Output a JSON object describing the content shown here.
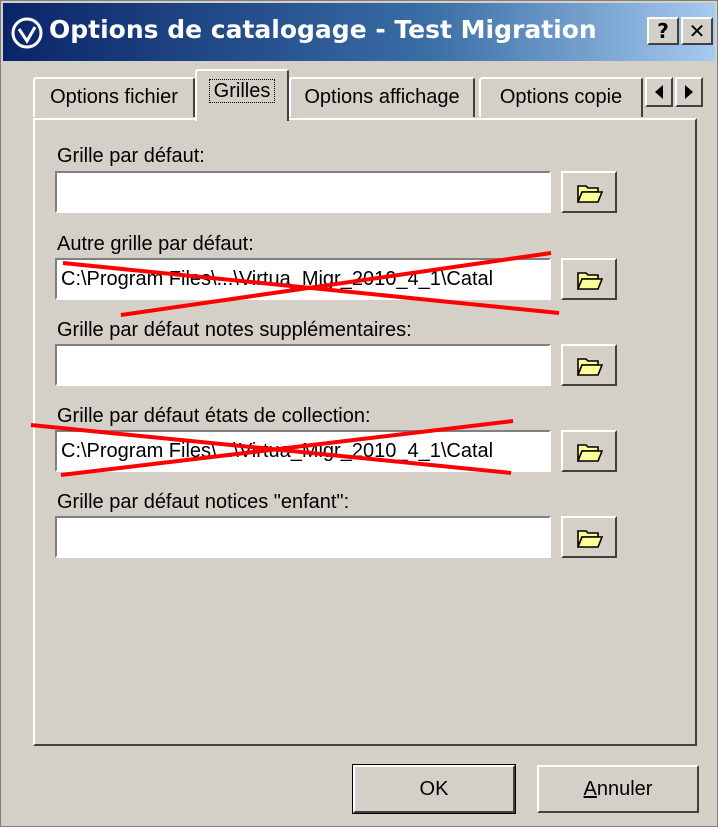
{
  "window": {
    "title": "Options de catalogage - Test Migration",
    "help_label": "?",
    "close_label": "✕"
  },
  "tabs": [
    {
      "label": "Options fichier",
      "active": false
    },
    {
      "label": "Grilles",
      "active": true
    },
    {
      "label": "Options affichage",
      "active": false
    },
    {
      "label": "Options copie",
      "active": false
    }
  ],
  "fields": [
    {
      "label": "Grille par défaut:",
      "value": "",
      "struck_out": false
    },
    {
      "label": "Autre grille par défaut:",
      "value": "C:\\Program Files\\...\\Virtua_Migr_2010_4_1\\Catal",
      "struck_out": true
    },
    {
      "label": "Grille par défaut notes supplémentaires:",
      "value": "",
      "struck_out": false
    },
    {
      "label": "Grille par défaut états de collection:",
      "value": "C:\\Program Files\\...\\Virtua_Migr_2010_4_1\\Catal",
      "struck_out": true
    },
    {
      "label": "Grille par défaut notices \"enfant\":",
      "value": "",
      "struck_out": false
    }
  ],
  "buttons": {
    "ok": "OK",
    "cancel_accel": "A",
    "cancel_rest": "nnuler"
  },
  "icons": {
    "browse": "folder-open-icon",
    "title": "app-icon",
    "tab_left": "arrow-left-icon",
    "tab_right": "arrow-right-icon"
  },
  "colors": {
    "title_bar": "#0a246a",
    "dialog_bg": "#d4d0c8",
    "strike": "#ff0000",
    "folder": "#ffff99"
  }
}
